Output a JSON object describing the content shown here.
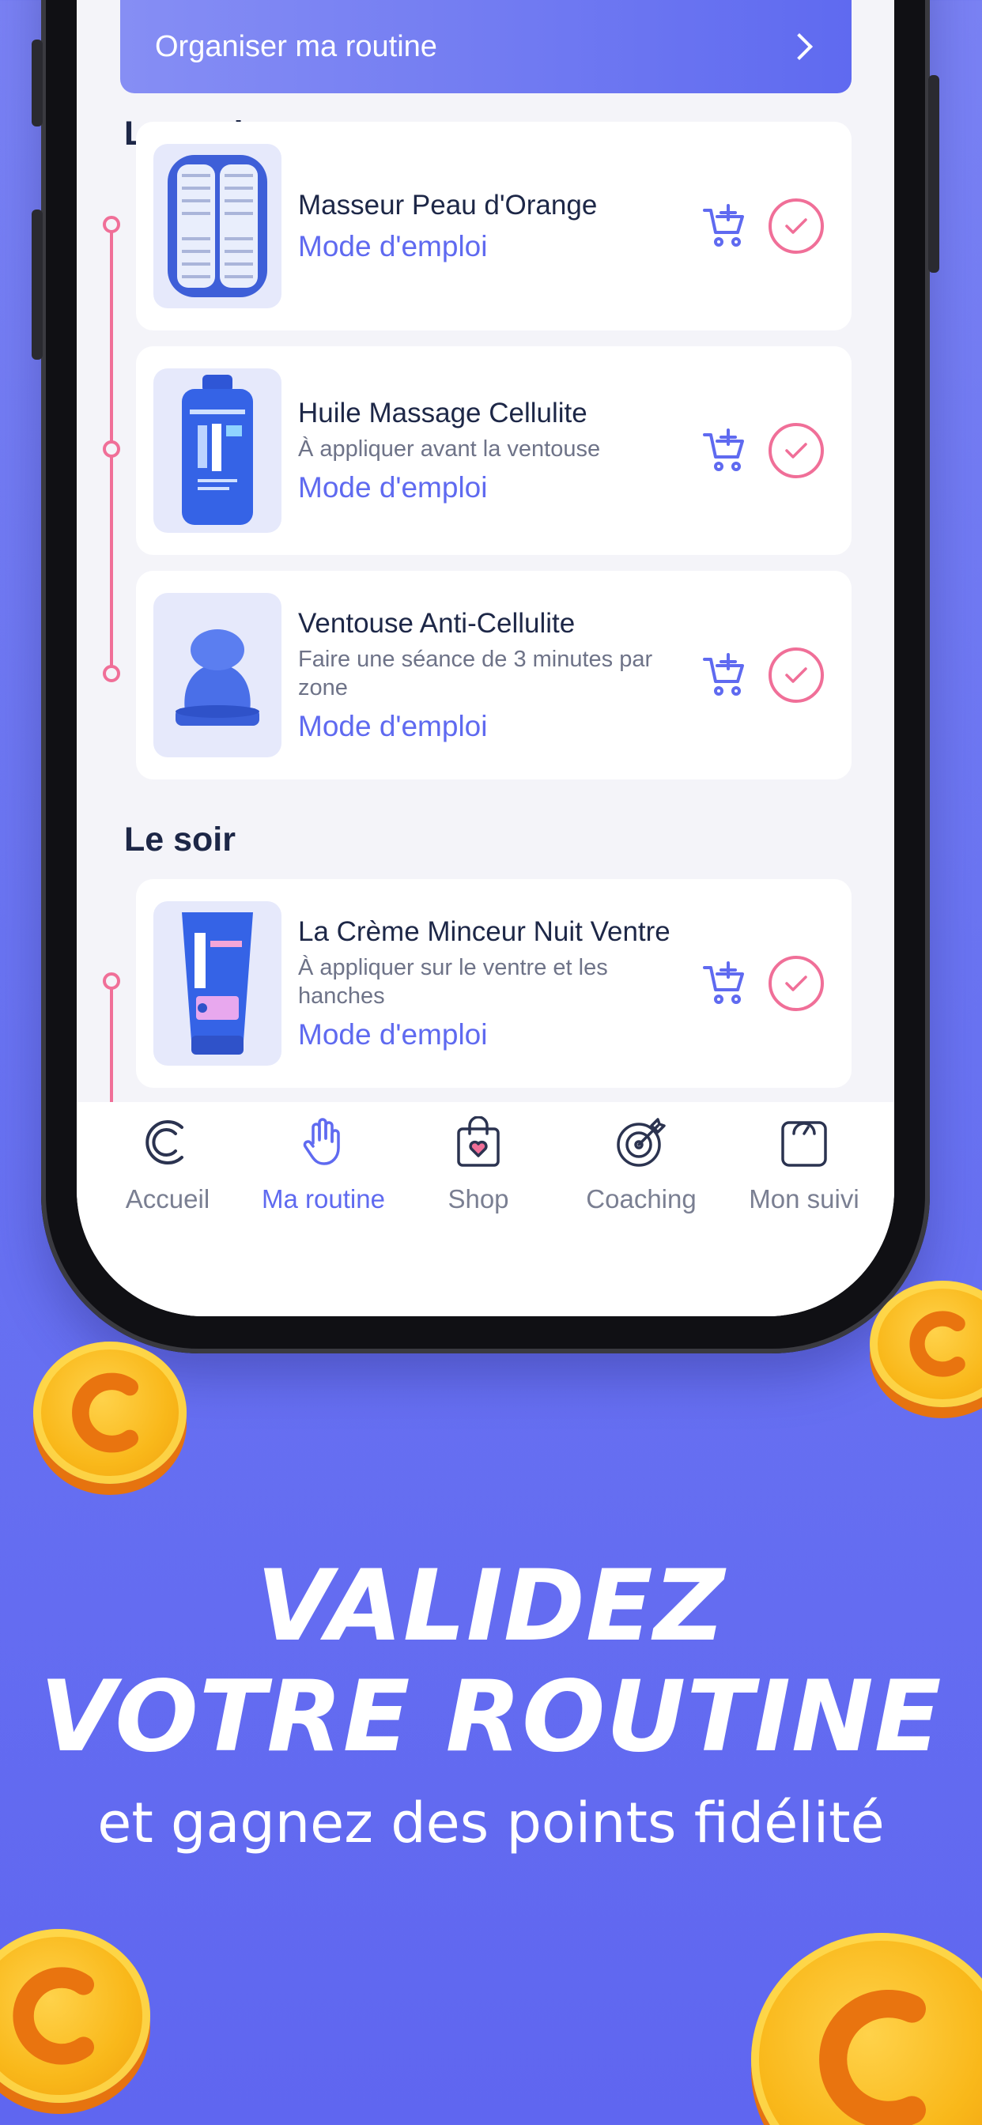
{
  "banner": {
    "label": "Organiser ma routine"
  },
  "sections": {
    "morning": "Le matin",
    "evening": "Le soir"
  },
  "products": [
    {
      "title": "Masseur Peau d'Orange",
      "subtitle": "",
      "link": "Mode d'emploi",
      "image_icon": "roller-massager"
    },
    {
      "title": "Huile Massage Cellulite",
      "subtitle": "À appliquer avant la ventouse",
      "link": "Mode d'emploi",
      "image_icon": "oil-bottle"
    },
    {
      "title": "Ventouse Anti-Cellulite",
      "subtitle": "Faire une séance de 3 minutes par zone",
      "link": "Mode d'emploi",
      "image_icon": "suction-cup"
    },
    {
      "title": "La Crème Minceur Nuit Ventre",
      "subtitle": "À appliquer sur le ventre et les hanches",
      "link": "Mode d'emploi",
      "image_icon": "cream-tube"
    }
  ],
  "tabs": [
    {
      "label": "Accueil",
      "icon": "logo-c-icon",
      "active": false
    },
    {
      "label": "Ma routine",
      "icon": "hand-icon",
      "active": true
    },
    {
      "label": "Shop",
      "icon": "shopping-bag-icon",
      "active": false
    },
    {
      "label": "Coaching",
      "icon": "target-icon",
      "active": false
    },
    {
      "label": "Mon suivi",
      "icon": "scale-icon",
      "active": false
    }
  ],
  "promo": {
    "line1": "VALIDEZ",
    "line2": "VOTRE ROUTINE",
    "tagline": "et gagnez des points fidélité"
  },
  "colors": {
    "accent": "#5f6af0",
    "timeline": "#f06f98",
    "background": "#6a74f2",
    "coin": "#f9b81a"
  }
}
